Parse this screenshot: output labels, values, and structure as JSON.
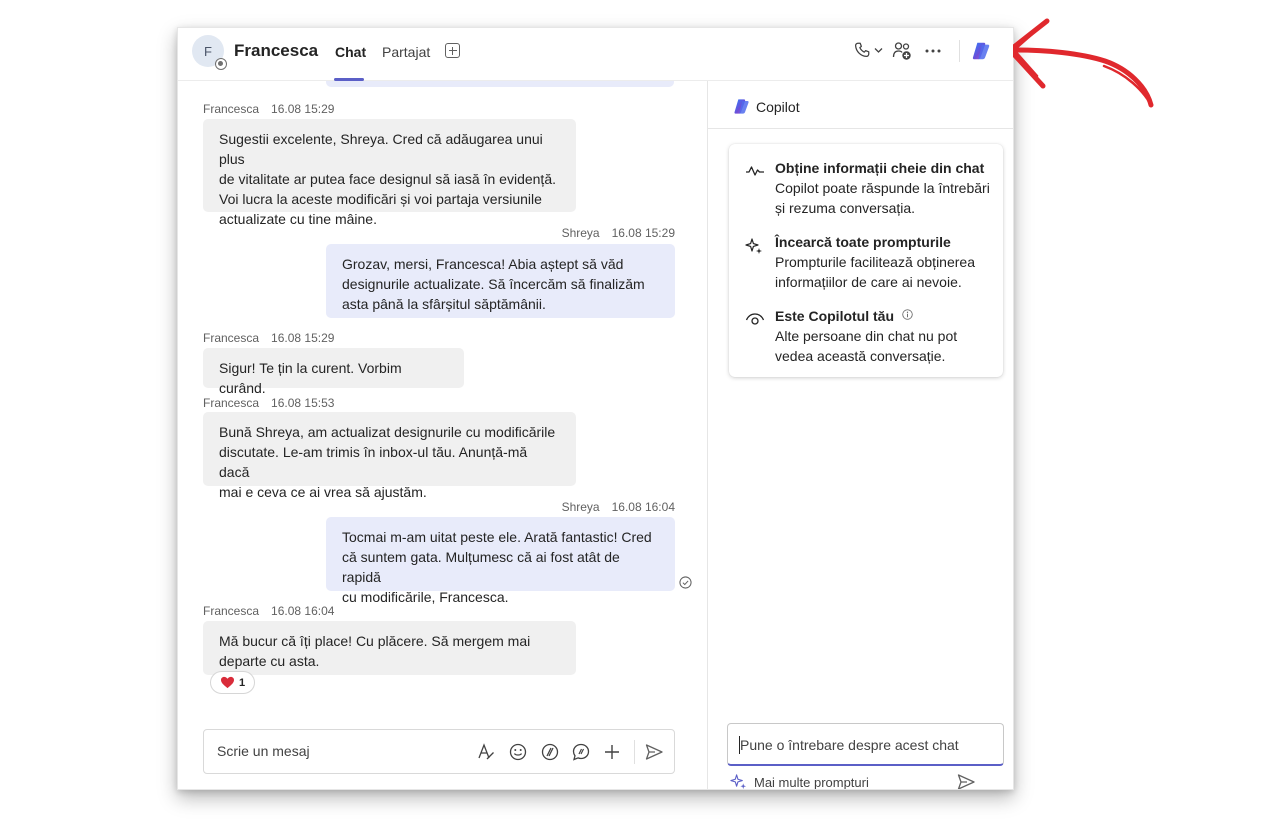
{
  "header": {
    "avatar_initial": "F",
    "contact_name": "Francesca",
    "tabs": [
      {
        "label": "Chat",
        "active": true
      },
      {
        "label": "Partajat",
        "active": false
      }
    ],
    "icons": [
      "phone-icon",
      "chevron-down-icon",
      "people-icon",
      "more-icon",
      "copilot-icon"
    ]
  },
  "messages": [
    {
      "direction": "in",
      "sender": "Francesca",
      "time": "16.08 15:29",
      "text": "Sugestii excelente, Shreya. Cred că adăugarea unui plus\nde vitalitate ar putea face designul să iasă în evidență.\nVoi lucra la aceste modificări și voi partaja versiunile\nactualizate cu tine mâine."
    },
    {
      "direction": "out",
      "sender": "Shreya",
      "time": "16.08 15:29",
      "text": "Grozav, mersi, Francesca! Abia aștept să văd\ndesignurile actualizate. Să încercăm să finalizăm\nasta până la sfârșitul săptămânii."
    },
    {
      "direction": "in",
      "sender": "Francesca",
      "time": "16.08 15:29",
      "text": "Sigur! Te țin la curent. Vorbim curând."
    },
    {
      "direction": "in",
      "sender": "Francesca",
      "time": "16.08 15:53",
      "text": "Bună Shreya, am actualizat designurile cu modificările\ndiscutate. Le-am trimis în inbox-ul tău. Anunță-mă dacă\nmai e ceva ce ai vrea să ajustăm."
    },
    {
      "direction": "out",
      "sender": "Shreya",
      "time": "16.08 16:04",
      "text": "Tocmai m-am uitat peste ele. Arată fantastic! Cred\ncă suntem gata. Mulțumesc că ai fost atât de rapidă\ncu modificările, Francesca."
    },
    {
      "direction": "in",
      "sender": "Francesca",
      "time": "16.08 16:04",
      "text": "Mă bucur că îți place! Cu plăcere. Să mergem mai\ndeparte cu asta.",
      "reaction": {
        "emoji": "heart",
        "count": "1"
      }
    }
  ],
  "compose": {
    "placeholder": "Scrie un mesaj",
    "icons": [
      "format-icon",
      "emoji-icon",
      "loop-icon",
      "copilot-chat-icon",
      "add-icon",
      "send-icon"
    ]
  },
  "copilot": {
    "title": "Copilot",
    "features": [
      {
        "icon": "activity-icon",
        "title": "Obține informații cheie din chat",
        "desc": "Copilot poate răspunde la întrebări\nși rezuma conversația."
      },
      {
        "icon": "sparkle-icon",
        "title": "Încearcă toate prompturile",
        "desc": "Prompturile facilitează obținerea\ninformațiilor de care ai nevoie."
      },
      {
        "icon": "eye-icon",
        "title": "Este Copilotul tău",
        "desc": "Alte persoane din chat nu pot\nvedea această conversație."
      }
    ],
    "input_placeholder": "Pune o întrebare despre acest chat",
    "more_prompts": "Mai multe prompturi"
  },
  "colors": {
    "accent": "#5b5fc7",
    "incoming_bubble": "#f0f0f0",
    "outgoing_bubble": "#e8ebfa",
    "annotation_arrow": "#e0282d"
  }
}
